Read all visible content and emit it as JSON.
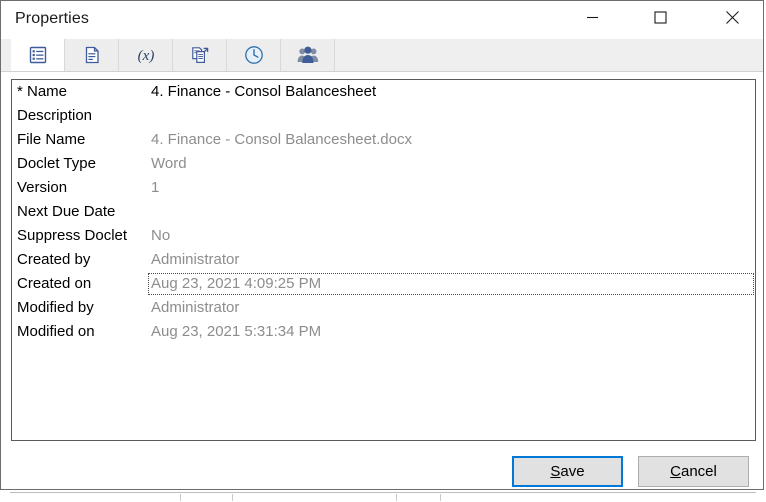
{
  "window": {
    "title": "Properties",
    "controls": [
      {
        "name": "minimize",
        "glyph": "minimize-icon",
        "label": "Minimize"
      },
      {
        "name": "maximize",
        "glyph": "maximize-icon",
        "label": "Maximize"
      },
      {
        "name": "close",
        "glyph": "close-icon",
        "label": "Close"
      }
    ]
  },
  "tabs": [
    {
      "id": "properties",
      "icon": "list-properties-icon",
      "selected": true
    },
    {
      "id": "document",
      "icon": "document-icon",
      "selected": false
    },
    {
      "id": "variables",
      "icon": "variable-fx-icon",
      "selected": false
    },
    {
      "id": "copy",
      "icon": "copy-export-icon",
      "selected": false
    },
    {
      "id": "history",
      "icon": "clock-history-icon",
      "selected": false
    },
    {
      "id": "users",
      "icon": "users-group-icon",
      "selected": false
    }
  ],
  "properties": [
    {
      "label": "* Name",
      "value": "4. Finance - Consol Balancesheet",
      "editable": true,
      "focused": false
    },
    {
      "label": "Description",
      "value": "",
      "editable": true,
      "focused": false
    },
    {
      "label": "File Name",
      "value": "4. Finance - Consol Balancesheet.docx",
      "editable": false,
      "focused": false
    },
    {
      "label": "Doclet Type",
      "value": "Word",
      "editable": false,
      "focused": false
    },
    {
      "label": "Version",
      "value": "1",
      "editable": false,
      "focused": false
    },
    {
      "label": "Next Due Date",
      "value": "",
      "editable": false,
      "focused": false
    },
    {
      "label": "Suppress Doclet",
      "value": "No",
      "editable": false,
      "focused": false
    },
    {
      "label": "Created by",
      "value": "Administrator",
      "editable": false,
      "focused": false
    },
    {
      "label": "Created on",
      "value": "Aug 23, 2021 4:09:25 PM",
      "editable": false,
      "focused": true
    },
    {
      "label": "Modified by",
      "value": "Administrator",
      "editable": false,
      "focused": false
    },
    {
      "label": "Modified on",
      "value": "Aug 23, 2021 5:31:34 PM",
      "editable": false,
      "focused": false
    }
  ],
  "buttons": {
    "save": {
      "prefix": "",
      "mnemonic": "S",
      "suffix": "ave",
      "focused": true
    },
    "cancel": {
      "prefix": "",
      "mnemonic": "C",
      "suffix": "ancel",
      "focused": false
    }
  },
  "colors": {
    "focus_blue": "#0078d7",
    "label_text": "#000000",
    "value_text": "#8d8d8d",
    "tab_bar": "#efefef",
    "button_face": "#e1e1e1",
    "window_border": "#6d6d6d"
  }
}
